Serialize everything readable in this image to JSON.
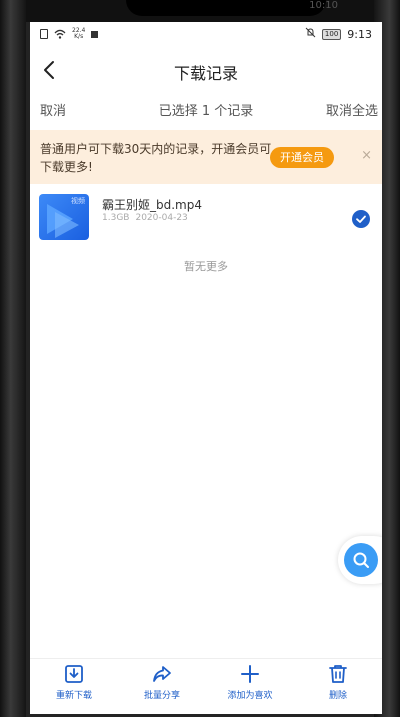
{
  "status_bar": {
    "net_speed": "22.4",
    "net_unit": "K/s",
    "battery": "100",
    "time": "9:13",
    "background_time": "10:10"
  },
  "header": {
    "title": "下载记录"
  },
  "selection": {
    "cancel_label": "取消",
    "selected_text": "已选择 1 个记录",
    "deselect_all_label": "取消全选"
  },
  "banner": {
    "text": "普通用户可下载30天内的记录，开通会员可下载更多!",
    "vip_button_label": "开通会员",
    "close_symbol": "×"
  },
  "files": [
    {
      "name": "霸王别姬_bd.mp4",
      "size": "1.3GB",
      "date": "2020-04-23",
      "thumb_tag": "视频",
      "selected": true
    }
  ],
  "no_more_text": "暂无更多",
  "toolbar": {
    "items": [
      {
        "label": "重新下载",
        "icon": "redownload-icon"
      },
      {
        "label": "批量分享",
        "icon": "share-icon"
      },
      {
        "label": "添加为喜欢",
        "icon": "plus-icon"
      },
      {
        "label": "删除",
        "icon": "trash-icon"
      }
    ]
  },
  "colors": {
    "accent_blue": "#1f5fc8",
    "banner_bg": "#fdeedd",
    "vip_orange": "#f59a10",
    "fab_blue": "#3a9cf5"
  }
}
